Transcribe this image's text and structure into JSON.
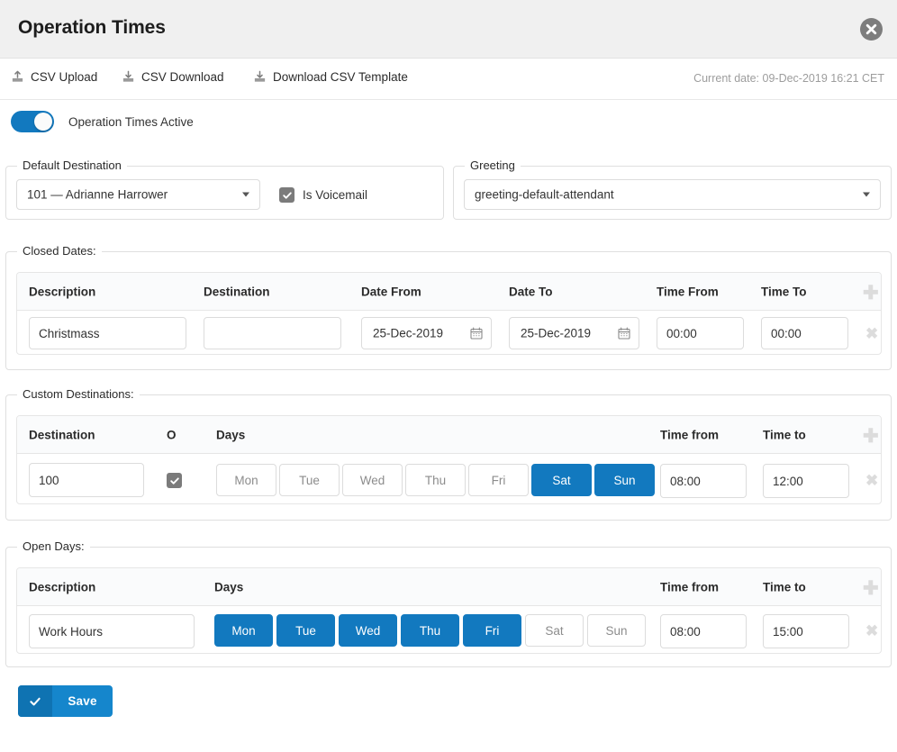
{
  "header": {
    "title": "Operation Times",
    "close_icon": "close-circle-icon"
  },
  "toolbar": {
    "csv_upload": "CSV Upload",
    "csv_download": "CSV Download",
    "download_template": "Download CSV Template",
    "current_date": "Current date: 09-Dec-2019 16:21 CET"
  },
  "toggle": {
    "label": "Operation Times Active",
    "state": "on",
    "color": "#1279bf"
  },
  "default_destination": {
    "legend": "Default Destination",
    "selected": "101  —  Adrianne Harrower",
    "voicemail_label": "Is Voicemail",
    "voicemail_checked": true
  },
  "greeting": {
    "legend": "Greeting",
    "selected": "greeting-default-attendant"
  },
  "closed_dates": {
    "legend": "Closed Dates:",
    "columns": [
      "Description",
      "Destination",
      "Date From",
      "Date To",
      "Time From",
      "Time To"
    ],
    "add_icon": "plus-icon",
    "rows": [
      {
        "description": "Christmass",
        "destination": "",
        "date_from": "25-Dec-2019",
        "date_to": "25-Dec-2019",
        "time_from": "00:00",
        "time_to": "00:00",
        "delete_icon": "close-icon"
      }
    ]
  },
  "custom_destinations": {
    "legend": "Custom Destinations:",
    "columns": [
      "Destination",
      "O",
      "Days",
      "Time from",
      "Time to"
    ],
    "add_icon": "plus-icon",
    "day_labels": [
      "Mon",
      "Tue",
      "Wed",
      "Thu",
      "Fri",
      "Sat",
      "Sun"
    ],
    "rows": [
      {
        "destination": "100",
        "checked": true,
        "days_active": [
          false,
          false,
          false,
          false,
          false,
          true,
          true
        ],
        "time_from": "08:00",
        "time_to": "12:00",
        "delete_icon": "close-icon"
      }
    ]
  },
  "open_days": {
    "legend": "Open Days:",
    "columns": [
      "Description",
      "Days",
      "Time from",
      "Time to"
    ],
    "add_icon": "plus-icon",
    "day_labels": [
      "Mon",
      "Tue",
      "Wed",
      "Thu",
      "Fri",
      "Sat",
      "Sun"
    ],
    "rows": [
      {
        "description": "Work Hours",
        "days_active": [
          true,
          true,
          true,
          true,
          true,
          false,
          false
        ],
        "time_from": "08:00",
        "time_to": "15:00",
        "delete_icon": "close-icon"
      }
    ]
  },
  "save": {
    "label": "Save",
    "icon": "check-icon",
    "color": "#1586cc"
  }
}
